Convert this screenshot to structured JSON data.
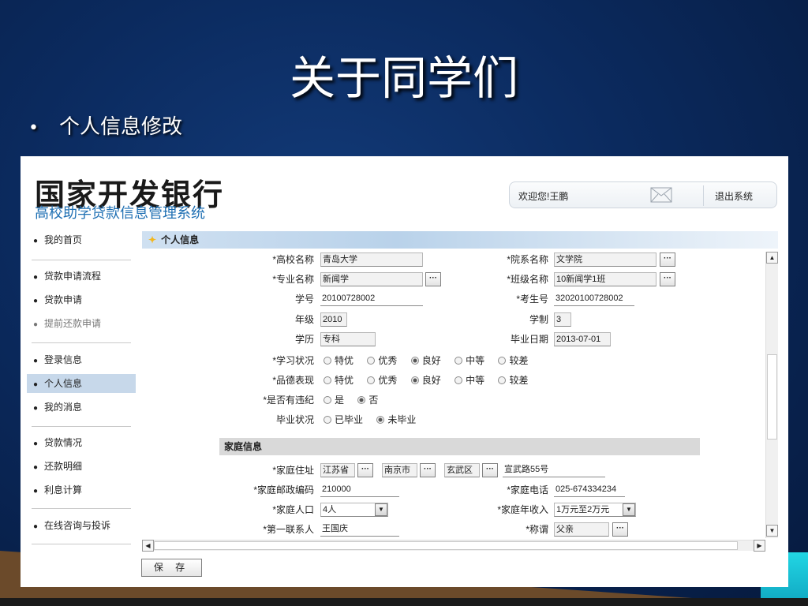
{
  "slide": {
    "title": "关于同学们",
    "bullet": "个人信息修改"
  },
  "header": {
    "logo_main": "国家开发银行",
    "logo_sub": "高校助学贷款信息管理系统",
    "welcome": "欢迎您!王鹏",
    "logout": "退出系统"
  },
  "nav": {
    "items": [
      "我的首页",
      "贷款申请流程",
      "贷款申请",
      "提前还款申请",
      "登录信息",
      "个人信息",
      "我的消息",
      "贷款情况",
      "还款明细",
      "利息计算",
      "在线咨询与投诉"
    ],
    "active": "个人信息"
  },
  "panel": {
    "title": "个人信息",
    "section_family": "家庭信息",
    "save": "保 存"
  },
  "labels": {
    "school": "*高校名称",
    "dept": "*院系名称",
    "major": "*专业名称",
    "class": "*班级名称",
    "student_no": "学号",
    "exam_no": "*考生号",
    "grade": "年级",
    "duration": "学制",
    "education": "学历",
    "grad_date": "毕业日期",
    "study_status": "*学习状况",
    "conduct": "*品德表现",
    "violation": "*是否有违纪",
    "grad_status": "毕业状况",
    "address": "*家庭住址",
    "postcode": "*家庭邮政编码",
    "phone": "*家庭电话",
    "population": "*家庭人口",
    "income": "*家庭年收入",
    "contact": "*第一联系人",
    "relation": "*称谓"
  },
  "values": {
    "school": "青岛大学",
    "dept": "文学院",
    "major": "新闻学",
    "class": "10新闻学1班",
    "student_no": "20100728002",
    "exam_no": "32020100728002",
    "grade": "2010",
    "duration": "3",
    "education": "专科",
    "grad_date": "2013-07-01",
    "province": "江苏省",
    "city": "南京市",
    "district": "玄武区",
    "street": "宣武路55号",
    "postcode": "210000",
    "phone": "025-674334234",
    "population": "4人",
    "income": "1万元至2万元",
    "contact": "王国庆",
    "relation": "父亲"
  },
  "options": {
    "rating": [
      "特优",
      "优秀",
      "良好",
      "中等",
      "较差"
    ],
    "rating_selected": "良好",
    "violation": [
      "是",
      "否"
    ],
    "violation_selected": "否",
    "grad": [
      "已毕业",
      "未毕业"
    ],
    "grad_selected": "未毕业"
  },
  "icons": {
    "mail": "envelope-icon",
    "more": "ellipsis-button",
    "dropdown": "chevron-down-icon"
  },
  "colors": {
    "slide_bg": "#0b2a5e",
    "nav_active": "#c7d8ea",
    "logo_sub": "#1e6fb3",
    "section_bar": "#d9d9d9"
  }
}
